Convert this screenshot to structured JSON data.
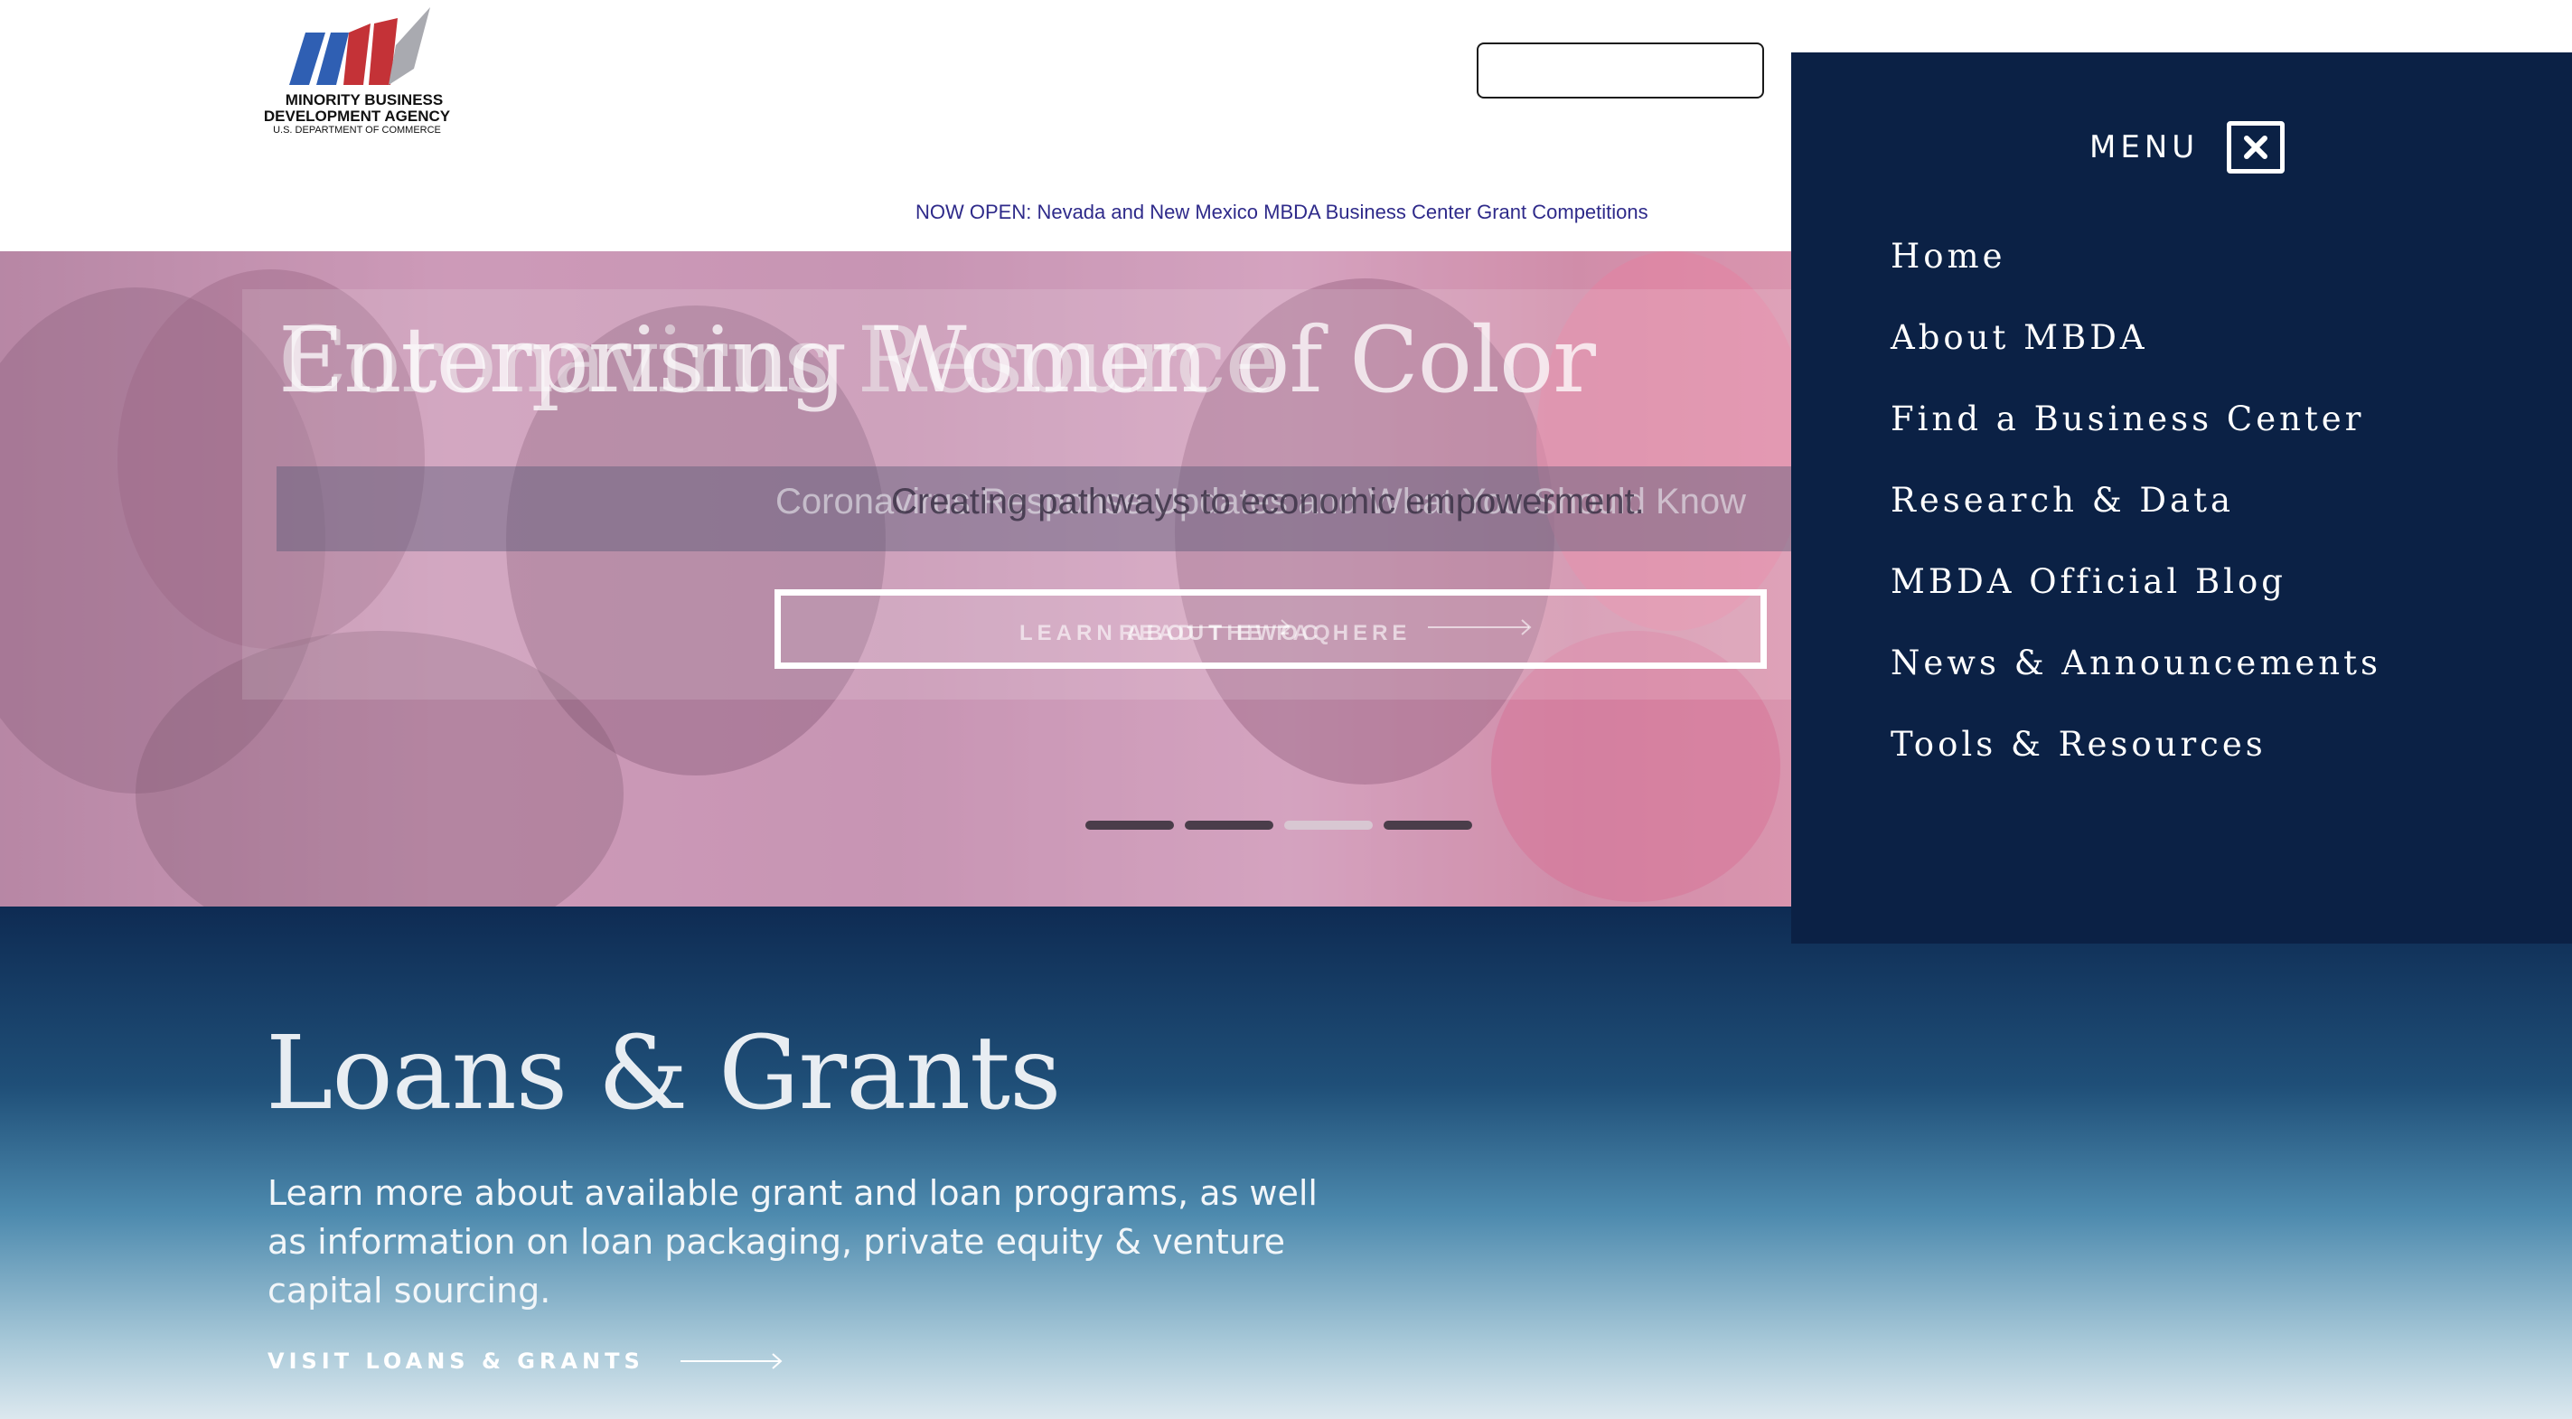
{
  "logo": {
    "line1": "MINORITY BUSINESS",
    "line2": "DEVELOPMENT AGENCY",
    "line3": "U.S. DEPARTMENT OF COMMERCE",
    "colors": {
      "blue": "#2f5fb3",
      "red": "#c43237",
      "gray": "#a9aab0"
    }
  },
  "search": {
    "value": "",
    "placeholder": ""
  },
  "announcement": "NOW OPEN: Nevada and New Mexico MBDA Business Center Grant Competitions",
  "hero": {
    "title_a": "Enterprising Women of Color",
    "title_b": "Coronavirus Resource",
    "subtitle_a": "Coronavirus Response Updates and What You Should Know",
    "subtitle_b": "Creating pathways to economic empowerment.",
    "button_a": "LEARN ABOUT EWOC HERE",
    "button_b": "READ THE FAQ",
    "slides": 4,
    "active_slide": 3
  },
  "loans": {
    "title": "Loans & Grants",
    "description": "Learn more about available grant and loan programs, as well as information on loan packaging, private equity & venture capital sourcing.",
    "link": "VISIT LOANS & GRANTS"
  },
  "menu": {
    "label": "MENU",
    "items": [
      "Home",
      "About MBDA",
      "Find a Business Center",
      "Research & Data",
      "MBDA Official Blog",
      "News & Announcements",
      "Tools & Resources"
    ],
    "background": "#0b2145"
  }
}
